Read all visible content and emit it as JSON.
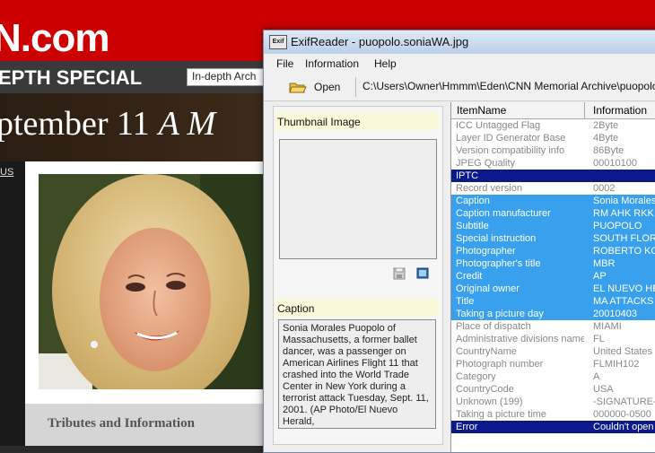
{
  "background_page": {
    "logo_text": "N.com",
    "special_text": "EPTH SPECIAL",
    "indepth_select": "In-depth Arch",
    "banner_main": "ptember 11",
    "banner_italic": "A M",
    "side_link": "US",
    "tributes_text": "Tributes and Information"
  },
  "window": {
    "title": "ExifReader - puopolo.soniaWA.jpg",
    "icon_text": "Exif",
    "menu": [
      "File",
      "Information",
      "Help"
    ],
    "toolbar": {
      "open_label": "Open",
      "path": "C:\\Users\\Owner\\Hmmm\\Eden\\CNN Memorial Archive\\puopolo.sonia"
    },
    "left_pane": {
      "thumbnail_header": "Thumbnail Image",
      "caption_header": "Caption",
      "caption_text": "Sonia Morales Puopolo of Massachusetts, a former ballet dancer, was a passenger on American Airlines Flight 11 that crashed into the World Trade Center in New York during a terrorist attack Tuesday, Sept. 11, 2001. (AP Photo/El Nuevo Herald,"
    },
    "grid": {
      "columns": [
        "ItemName",
        "Information"
      ],
      "rows": [
        {
          "name": "ICC Untagged Flag",
          "value": "2Byte",
          "style": "normal"
        },
        {
          "name": "Layer ID Generator Base",
          "value": "4Byte",
          "style": "normal"
        },
        {
          "name": "Version compatibility info",
          "value": "86Byte",
          "style": "normal"
        },
        {
          "name": "JPEG Quality",
          "value": "00010100",
          "style": "normal"
        },
        {
          "name": "IPTC",
          "value": "",
          "style": "header"
        },
        {
          "name": "Record version",
          "value": "0002",
          "style": "normal"
        },
        {
          "name": "Caption",
          "value": "Sonia Morales",
          "style": "selected"
        },
        {
          "name": "Caption manufacturer",
          "value": "RM AHK RKK",
          "style": "selected"
        },
        {
          "name": "Subtitle",
          "value": "PUOPOLO",
          "style": "selected"
        },
        {
          "name": "Special instruction",
          "value": "SOUTH FLOR",
          "style": "selected"
        },
        {
          "name": "Photographer",
          "value": "ROBERTO KO",
          "style": "selected"
        },
        {
          "name": "Photographer's title",
          "value": "MBR",
          "style": "selected"
        },
        {
          "name": "Credit",
          "value": "AP",
          "style": "selected"
        },
        {
          "name": "Original owner",
          "value": "EL NUEVO HE",
          "style": "selected"
        },
        {
          "name": "Title",
          "value": "MA ATTACKS",
          "style": "selected"
        },
        {
          "name": "Taking a picture day",
          "value": "20010403",
          "style": "selected"
        },
        {
          "name": "Place of dispatch",
          "value": "MIAMI",
          "style": "normal"
        },
        {
          "name": "Administrative divisions name",
          "value": "FL",
          "style": "normal"
        },
        {
          "name": "CountryName",
          "value": "United States",
          "style": "normal"
        },
        {
          "name": "Photograph number",
          "value": "FLMIH102",
          "style": "normal"
        },
        {
          "name": "Category",
          "value": "A",
          "style": "normal"
        },
        {
          "name": "CountryCode",
          "value": "USA",
          "style": "normal"
        },
        {
          "name": "Unknown (199)",
          "value": "-SIGNATURE-",
          "style": "normal"
        },
        {
          "name": "Taking a picture time",
          "value": "000000-0500",
          "style": "normal"
        },
        {
          "name": "Error",
          "value": "Couldn't open",
          "style": "header"
        }
      ]
    }
  }
}
